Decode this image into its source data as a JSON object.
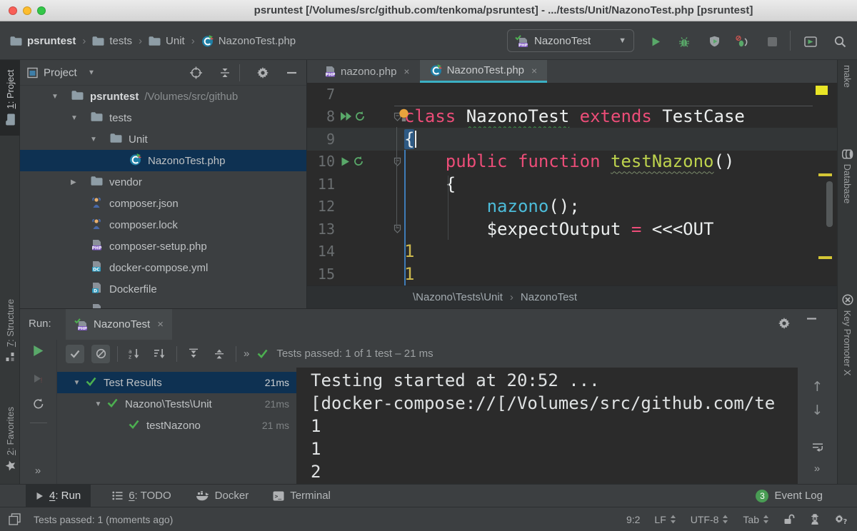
{
  "window": {
    "title": "psruntest [/Volumes/src/github.com/tenkoma/psruntest] - .../tests/Unit/NazonoTest.php [psruntest]"
  },
  "navbar": {
    "breadcrumbs": [
      {
        "label": "psruntest",
        "icon": "folder",
        "bold": true
      },
      {
        "label": "tests",
        "icon": "folder"
      },
      {
        "label": "Unit",
        "icon": "folder"
      },
      {
        "label": "NazonoTest.php",
        "icon": "phpunit"
      }
    ],
    "run_config": {
      "label": "NazonoTest",
      "icon": "phpcheck"
    }
  },
  "left_strip": [
    {
      "label": "1: Project",
      "icon": "folder",
      "mnemonic": "1",
      "active": true
    },
    {
      "label": "7: Structure",
      "icon": "structure",
      "mnemonic": "7"
    },
    {
      "label": "2: Favorites",
      "icon": "star",
      "mnemonic": "2"
    }
  ],
  "right_strip": [
    {
      "label": "make",
      "icon": ""
    },
    {
      "label": "Database",
      "icon": "database"
    },
    {
      "label": "Key Promoter X",
      "icon": "keyx"
    }
  ],
  "project_panel": {
    "title": "Project",
    "tree": [
      {
        "level": 1,
        "arrow": "open",
        "icon": "folder",
        "label": "psruntest",
        "bold": true,
        "suffix": "/Volumes/src/github"
      },
      {
        "level": 2,
        "arrow": "open",
        "icon": "folder",
        "label": "tests"
      },
      {
        "level": 3,
        "arrow": "open",
        "icon": "folder",
        "label": "Unit"
      },
      {
        "level": 4,
        "icon": "phpunit",
        "label": "NazonoTest.php",
        "selected": true
      },
      {
        "level": 2,
        "arrow": "closed",
        "icon": "folder",
        "label": "vendor"
      },
      {
        "level": 2,
        "icon": "composer",
        "label": "composer.json"
      },
      {
        "level": 2,
        "icon": "composer",
        "label": "composer.lock"
      },
      {
        "level": 2,
        "icon": "php",
        "label": "composer-setup.php"
      },
      {
        "level": 2,
        "icon": "dc",
        "label": "docker-compose.yml"
      },
      {
        "level": 2,
        "icon": "dockerfile",
        "label": "Dockerfile"
      },
      {
        "level": 2,
        "icon": "php",
        "label": ""
      }
    ]
  },
  "editor": {
    "tabs": [
      {
        "label": "nazono.php",
        "icon": "php",
        "active": false
      },
      {
        "label": "NazonoTest.php",
        "icon": "phpunit",
        "active": true
      }
    ],
    "code": [
      {
        "n": "7",
        "tokens": []
      },
      {
        "n": "8",
        "gutter": [
          "doubleplay",
          "rerun"
        ],
        "fold": true,
        "separator": true,
        "bulb": true,
        "tokens": [
          [
            "class ",
            "kw"
          ],
          [
            "NazonoTest",
            "id wavy"
          ],
          [
            " ",
            "pl"
          ],
          [
            "extends",
            "kw"
          ],
          [
            " TestCase",
            "pl"
          ]
        ]
      },
      {
        "n": "9",
        "caret": true,
        "tokens": [
          [
            "{",
            "brace"
          ]
        ]
      },
      {
        "n": "10",
        "gutter": [
          "play",
          "rerun"
        ],
        "fold": true,
        "tokens": [
          [
            "    ",
            "pl"
          ],
          [
            "public function ",
            "kw"
          ],
          [
            "testNazono",
            "fn wavy2"
          ],
          [
            "()",
            "pl"
          ]
        ]
      },
      {
        "n": "11",
        "tokens": [
          [
            "    {",
            "pl"
          ]
        ]
      },
      {
        "n": "12",
        "tokens": [
          [
            "        ",
            "pl"
          ],
          [
            "nazono",
            "call"
          ],
          [
            "();",
            "pl"
          ]
        ]
      },
      {
        "n": "13",
        "fold": true,
        "tokens": [
          [
            "        ",
            "pl"
          ],
          [
            "$expectOutput ",
            "pl"
          ],
          [
            "=",
            "kw"
          ],
          [
            " <<<OUT",
            "pl"
          ]
        ]
      },
      {
        "n": "14",
        "tokens": [
          [
            "1",
            "str"
          ]
        ]
      },
      {
        "n": "15",
        "tokens": [
          [
            "1",
            "str"
          ]
        ]
      }
    ],
    "breadcrumbs": [
      "\\Nazono\\Tests\\Unit",
      "NazonoTest"
    ]
  },
  "run_panel": {
    "label": "Run:",
    "tab": {
      "label": "NazonoTest",
      "icon": "phpcheck"
    },
    "status": {
      "text": "Tests passed: 1 of 1 test – 21 ms"
    },
    "tree": [
      {
        "level": 1,
        "arrow": true,
        "label": "Test Results",
        "time": "21ms",
        "selected": true
      },
      {
        "level": 2,
        "arrow": true,
        "label": "Nazono\\Tests\\Unit",
        "time": "21ms"
      },
      {
        "level": 3,
        "label": "testNazono",
        "time": "21 ms"
      }
    ],
    "console": [
      "Testing started at 20:52 ...",
      "[docker-compose://[/Volumes/src/github.com/te",
      "1",
      "1",
      "2"
    ]
  },
  "bottom_bar": {
    "items": [
      {
        "label": "4: Run",
        "icon": "playgray",
        "mnemonic": "4",
        "active": true
      },
      {
        "label": "6: TODO",
        "icon": "todo",
        "mnemonic": "6"
      },
      {
        "label": "Docker",
        "icon": "docker"
      },
      {
        "label": "Terminal",
        "icon": "terminal"
      }
    ],
    "event_log": {
      "badge": "3",
      "label": "Event Log"
    }
  },
  "status_bar": {
    "message": "Tests passed: 1 (moments ago)",
    "caret_position": "9:2",
    "line_separator": "LF",
    "encoding": "UTF-8",
    "indent": "Tab"
  },
  "colors": {
    "panel": "#3c3f41",
    "editor_bg": "#2b2b2b",
    "selection_blue": "#0e3152",
    "tab_underline_cyan": "#3bb0c4",
    "keyword_pink": "#ec4d78",
    "function_green": "#bdd24d",
    "call_cyan": "#4cbcd9",
    "heredoc_yellow": "#cdb94e",
    "run_green": "#59a869",
    "test_check_green": "#4caf50",
    "error_stripe_yellow": "#e9e526"
  }
}
